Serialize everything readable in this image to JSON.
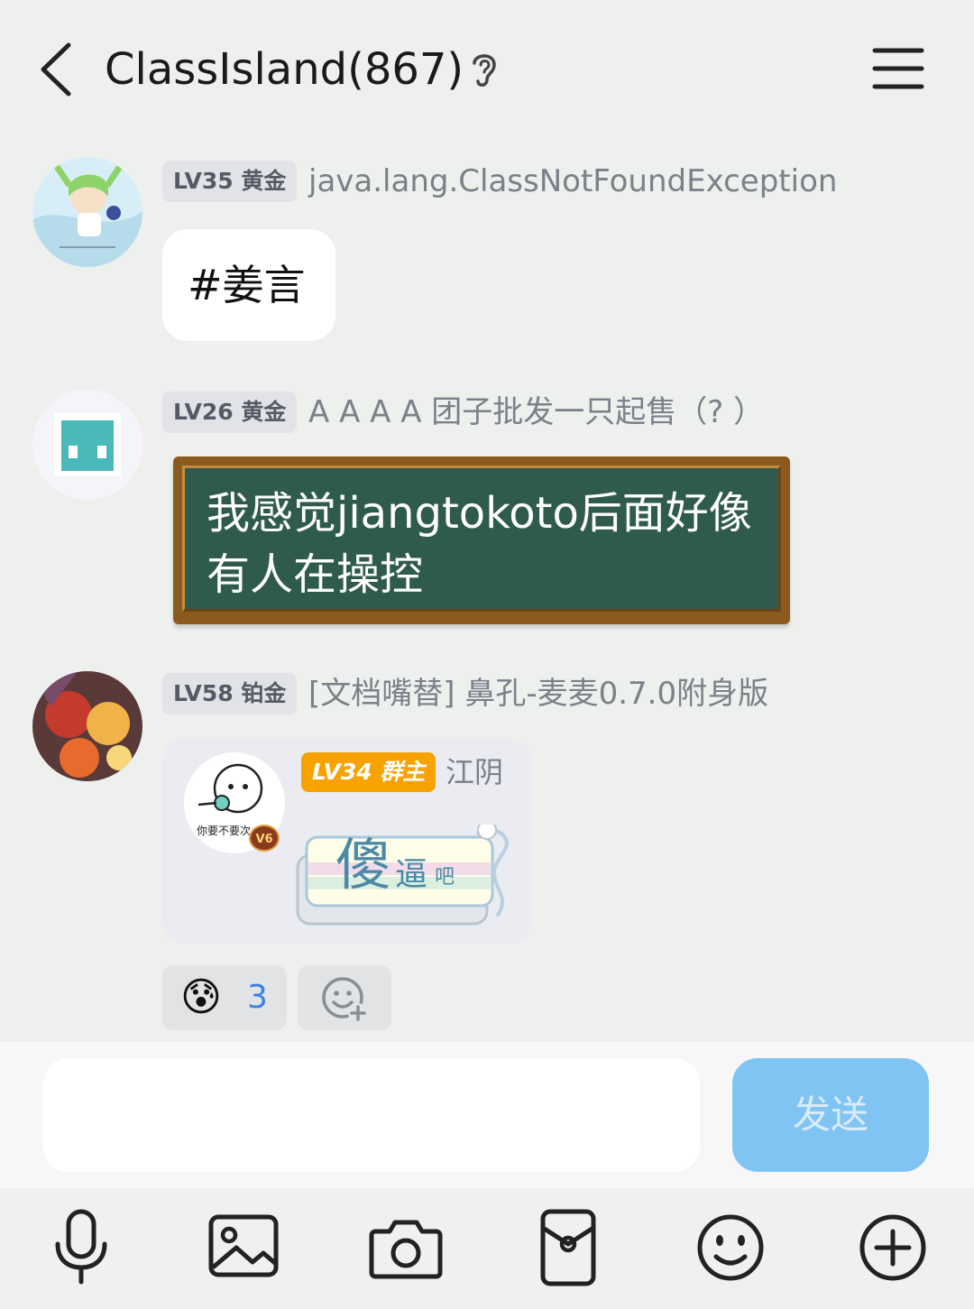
{
  "header": {
    "title": "ClassIsland(867)"
  },
  "messages": [
    {
      "level_badge": "LV35 黄金",
      "nickname": "java.lang.ClassNotFoundException",
      "text": "#姜言"
    },
    {
      "level_badge": "LV26 黄金",
      "nickname": "A A A A 团子批发一只起售（? ）",
      "text": "我感觉jiangtokoto后面好像有人在操控"
    },
    {
      "level_badge": "LV58 铂金",
      "nickname": "[文档嘴替] 鼻孔-麦麦0.7.0附身版",
      "quote": {
        "level_badge": "LV34 群主",
        "nickname": "江阴",
        "avatar_caption": "你要不要次",
        "vip_badge": "V6",
        "sticker_big": "傻",
        "sticker_small": "逼",
        "sticker_tiny": "吧"
      },
      "reaction": {
        "emoji": "😰",
        "count": "3"
      }
    }
  ],
  "input": {
    "value": "",
    "send_label": "发送"
  },
  "toolbar": {
    "items": [
      "microphone-icon",
      "image-icon",
      "camera-icon",
      "red-packet-icon",
      "emoji-icon",
      "plus-icon"
    ]
  },
  "colors": {
    "background": "#eef0ee",
    "send_button": "#80c4f4",
    "badge_bg": "#e2e3e6",
    "board_green": "#2f5a4e",
    "board_frame": "#8a5a1f",
    "owner_badge": "#f7a200"
  }
}
